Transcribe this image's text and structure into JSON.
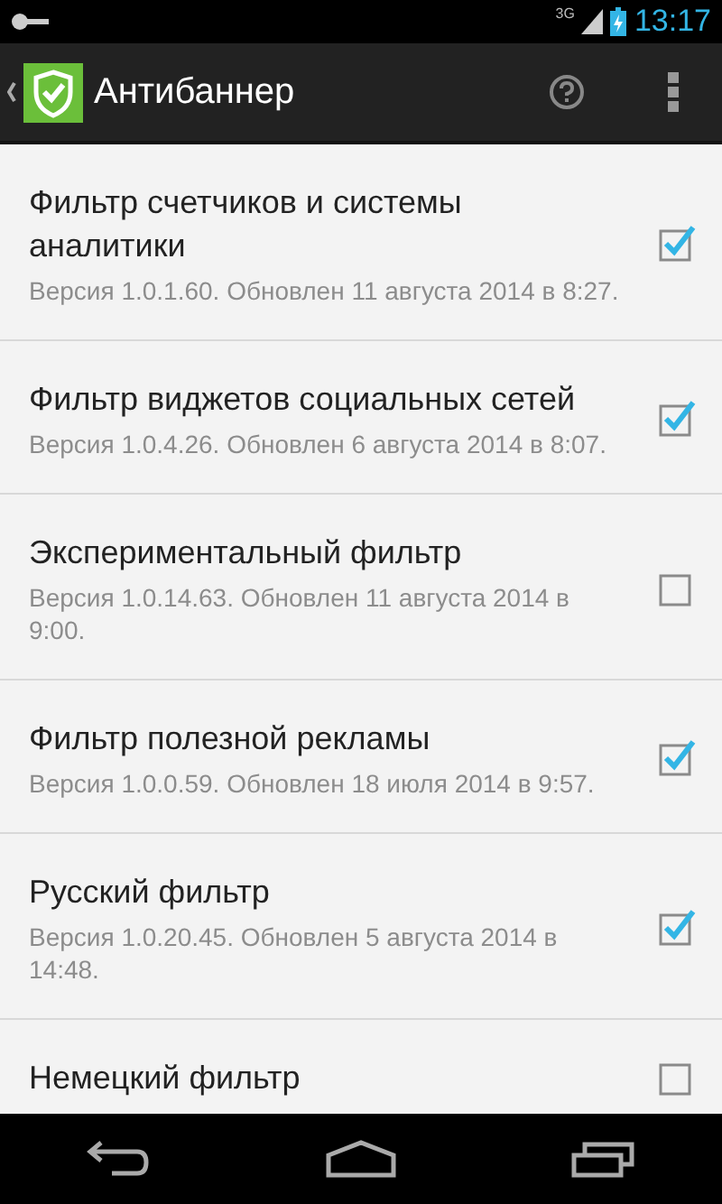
{
  "status_bar": {
    "network": "3G",
    "time": "13:17"
  },
  "action_bar": {
    "title": "Антибаннер"
  },
  "filters": [
    {
      "title": "Фильтр счетчиков и системы аналитики",
      "subtitle": "Версия 1.0.1.60. Обновлен 11 августа 2014 в 8:27.",
      "checked": true
    },
    {
      "title": "Фильтр виджетов социальных сетей",
      "subtitle": "Версия 1.0.4.26. Обновлен 6 августа 2014 в 8:07.",
      "checked": true
    },
    {
      "title": "Экспериментальный фильтр",
      "subtitle": "Версия 1.0.14.63. Обновлен 11 августа 2014 в 9:00.",
      "checked": false
    },
    {
      "title": "Фильтр полезной рекламы",
      "subtitle": "Версия 1.0.0.59. Обновлен 18 июля 2014 в 9:57.",
      "checked": true
    },
    {
      "title": "Русский фильтр",
      "subtitle": "Версия 1.0.20.45. Обновлен 5 августа 2014 в 14:48.",
      "checked": true
    },
    {
      "title": "Немецкий фильтр",
      "checked": false
    }
  ]
}
